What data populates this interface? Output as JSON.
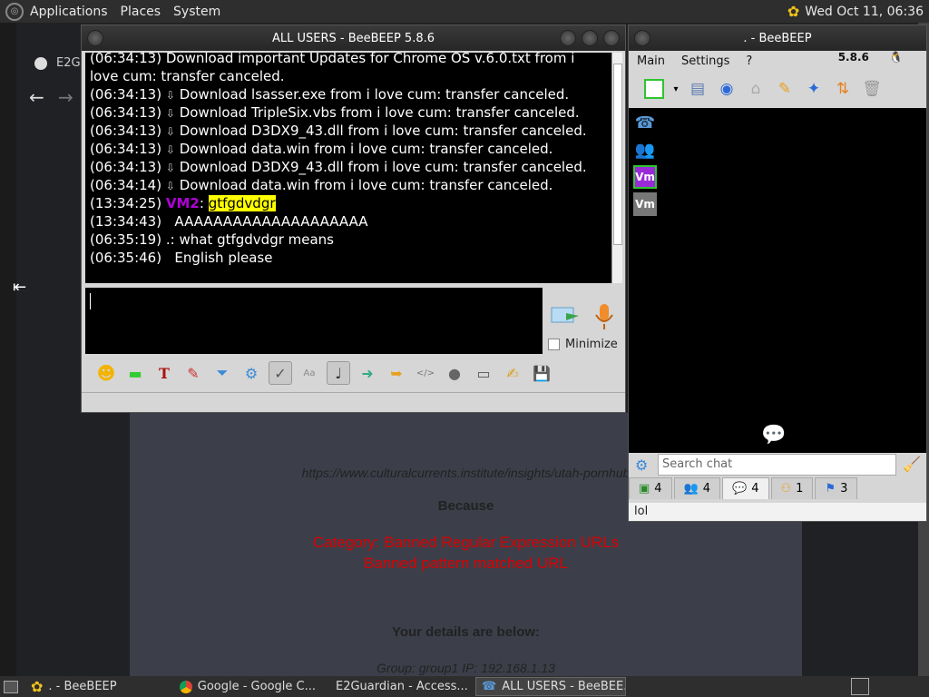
{
  "top_panel": {
    "menus": [
      "Applications",
      "Places",
      "System"
    ],
    "clock": "Wed Oct 11, 06:36"
  },
  "browser": {
    "tab_title": "E2G",
    "page": {
      "url_text": "https://www.culturalcurrents.institute/insights/utah-pornhub",
      "because": "Because",
      "category": "Category: Banned Regular Expression URLs",
      "reason": "Banned pattern matched URL",
      "details_heading": "Your details are below:",
      "group_ip": "Group: group1   IP: 192.168.1.13"
    }
  },
  "chat_window": {
    "title": "ALL USERS - BeeBEEP 5.8.6",
    "first_partial_line": "(06:34:13)   Download important Updates for Chrome OS v.6.0.txt from i",
    "first_partial_line_2": "love cum: transfer canceled.",
    "messages": [
      {
        "time": "(06:34:13)",
        "text": "Download lsasser.exe from i love cum: transfer canceled."
      },
      {
        "time": "(06:34:13)",
        "text": "Download TripleSix.vbs from i love cum: transfer canceled."
      },
      {
        "time": "(06:34:13)",
        "text": "Download D3DX9_43.dll from i love cum: transfer canceled."
      },
      {
        "time": "(06:34:13)",
        "text": "Download data.win from i love cum: transfer canceled."
      },
      {
        "time": "(06:34:13)",
        "text": "Download D3DX9_43.dll from i love cum: transfer canceled."
      },
      {
        "time": "(06:34:14)",
        "text": "Download data.win from i love cum: transfer canceled."
      }
    ],
    "vm2_line": {
      "time": "(13:34:25)",
      "sender": "VM2",
      "text": "gtfgdvdgr"
    },
    "line_aaa": {
      "time": "(13:34:43)",
      "text": "AAAAAAAAAAAAAAAAAAAA"
    },
    "line_means": {
      "time": "(06:35:19)",
      "text": ".: what gtfgdvdgr means"
    },
    "line_english": {
      "time": "(06:35:46)",
      "text": "English please"
    },
    "minimize_label": "Minimize"
  },
  "bb_window": {
    "title": ". - BeeBEEP",
    "menus": [
      "Main",
      "Settings",
      "?"
    ],
    "version": "5.8.6",
    "search_placeholder": "Search chat",
    "tabs": [
      {
        "icon": "users-icon",
        "count": "4"
      },
      {
        "icon": "groups-icon",
        "count": "4"
      },
      {
        "icon": "chats-icon",
        "count": "4"
      },
      {
        "icon": "shares-icon",
        "count": "1"
      },
      {
        "icon": "files-icon",
        "count": "3"
      }
    ],
    "last_message": "lol",
    "side_icons": [
      "Vm",
      "Vm"
    ]
  },
  "taskbar": {
    "tasks": [
      ". - BeeBEEP",
      "Google - Google C...",
      "E2Guardian - Access...",
      "ALL USERS - BeeBEE..."
    ]
  },
  "colors": {
    "accent_vm": "#b000d8",
    "highlight": "#ffff00",
    "banned_red": "#dd0000"
  }
}
